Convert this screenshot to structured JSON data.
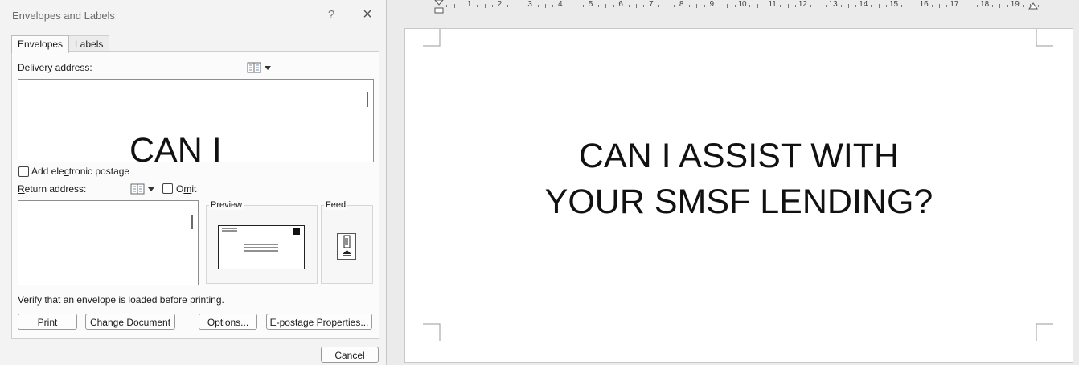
{
  "dialog": {
    "title": "Envelopes and Labels",
    "help_glyph": "?",
    "close_glyph": "×",
    "tabs": [
      {
        "label": "Envelopes",
        "active": true
      },
      {
        "label": "Labels",
        "active": false
      }
    ],
    "delivery_label_first": "D",
    "delivery_label_rest": "elivery address:",
    "delivery_text": "CAN I",
    "add_postage_pre": "Add ele",
    "add_postage_key": "c",
    "add_postage_post": "tronic postage",
    "return_label_first": "R",
    "return_label_rest": "eturn address:",
    "omit_pre": "O",
    "omit_key": "m",
    "omit_post": "it",
    "preview_label": "Preview",
    "feed_label": "Feed",
    "verify_text": "Verify that an envelope is loaded before printing.",
    "buttons": {
      "print": "Print",
      "change_document": "Change Document",
      "options": "Options...",
      "epostage": "E-postage Properties...",
      "cancel": "Cancel"
    }
  },
  "document": {
    "line1": "CAN I ASSIST WITH",
    "line2": "YOUR SMSF LENDING?"
  },
  "ruler": {
    "numbers": [
      "1",
      "2",
      "3",
      "4",
      "5",
      "6",
      "7",
      "8",
      "9",
      "10",
      "11",
      "12",
      "13",
      "14",
      "15",
      "16",
      "17",
      "18",
      "19"
    ]
  },
  "colors": {
    "dialog_bg": "#f3f3f3",
    "document_bg": "#ebebeb",
    "page_bg": "#ffffff"
  }
}
